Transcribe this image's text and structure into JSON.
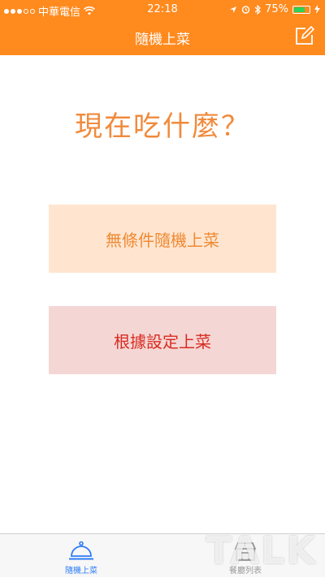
{
  "status_bar": {
    "carrier": "中華電信",
    "time": "22:18",
    "battery_percent": "75%",
    "battery_level": 0.75
  },
  "nav": {
    "title": "隨機上菜",
    "edit_icon": "edit-icon"
  },
  "main": {
    "question": "現在吃什麼？",
    "random_button": "無條件隨機上菜",
    "settings_button": "根據設定上菜"
  },
  "tabbar": {
    "items": [
      {
        "label": "隨機上菜",
        "icon": "service-bell-icon",
        "active": true
      },
      {
        "label": "餐廳列表",
        "icon": "store-icon",
        "active": false
      }
    ]
  },
  "watermark": "TALK",
  "colors": {
    "header": "#ff8a1e",
    "question": "#f08a3c",
    "random_bg": "#ffe5d0",
    "random_text": "#ee8a33",
    "settings_bg": "#f4d7d4",
    "settings_text": "#d92b22",
    "tab_active": "#2e7cf6"
  }
}
